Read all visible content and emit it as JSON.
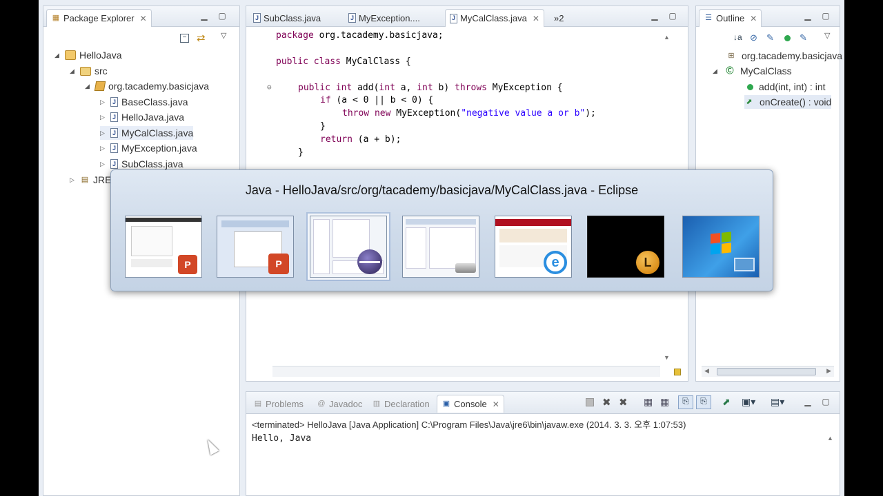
{
  "package_explorer": {
    "tab_label": "Package Explorer",
    "tree": [
      {
        "label": "HelloJava",
        "twisty": "◢"
      },
      {
        "label": "src",
        "twisty": "◢"
      },
      {
        "label": "org.tacademy.basicjava",
        "twisty": "◢"
      },
      {
        "label": "BaseClass.java",
        "twisty": "▷"
      },
      {
        "label": "HelloJava.java",
        "twisty": "▷"
      },
      {
        "label": "MyCalClass.java",
        "twisty": "▷"
      },
      {
        "label": "MyException.java",
        "twisty": "▷"
      },
      {
        "label": "SubClass.java",
        "twisty": "▷"
      },
      {
        "label": "JRE",
        "twisty": "▷"
      }
    ]
  },
  "editor": {
    "tabs": [
      {
        "label": "SubClass.java"
      },
      {
        "label": "MyException...."
      },
      {
        "label": "MyCalClass.java"
      }
    ],
    "overflow_label": "»2",
    "code": {
      "l1_kw": "package",
      "l1_rest": " org.tacademy.basicjava;",
      "l2_kw": "public class",
      "l2_rest": " MyCalClass {",
      "l3_kw1": "public int",
      "l3_mid": " add(",
      "l3_kw2": "int",
      "l3_mid2": " a, ",
      "l3_kw3": "int",
      "l3_mid3": " b) ",
      "l3_kw4": "throws",
      "l3_rest": " MyException {",
      "l4_kw": "if",
      "l4_rest": " (a < 0 || b < 0) {",
      "l5_kw1": "throw new",
      "l5_mid": " MyException(",
      "l5_str": "\"negative value a or b\"",
      "l5_rest": ");",
      "l6": "}",
      "l7_kw": "return",
      "l7_rest": " (a + b);",
      "l8": "}"
    }
  },
  "outline": {
    "tab_label": "Outline",
    "items": [
      {
        "label": "org.tacademy.basicjava"
      },
      {
        "label": "MyCalClass"
      },
      {
        "label": "add(int, int) : int"
      },
      {
        "label": "onCreate() : void"
      }
    ]
  },
  "bottom": {
    "tabs": [
      {
        "label": "Problems"
      },
      {
        "label": "Javadoc"
      },
      {
        "label": "Declaration"
      },
      {
        "label": "Console"
      }
    ],
    "status": "<terminated> HelloJava [Java Application] C:\\Program Files\\Java\\jre6\\bin\\javaw.exe (2014. 3. 3. 오후 1:07:53)",
    "output": "Hello, Java"
  },
  "switcher": {
    "title": "Java - HelloJava/src/org/tacademy/basicjava/MyCalClass.java - Eclipse",
    "windows": [
      {
        "icon": "powerpoint-icon"
      },
      {
        "icon": "powerpoint-icon"
      },
      {
        "icon": "eclipse-icon"
      },
      {
        "icon": "drive-icon"
      },
      {
        "icon": "internet-explorer-icon"
      },
      {
        "icon": "lecture-app-icon",
        "badge": "L"
      },
      {
        "icon": "windows-desktop-icon"
      }
    ]
  }
}
